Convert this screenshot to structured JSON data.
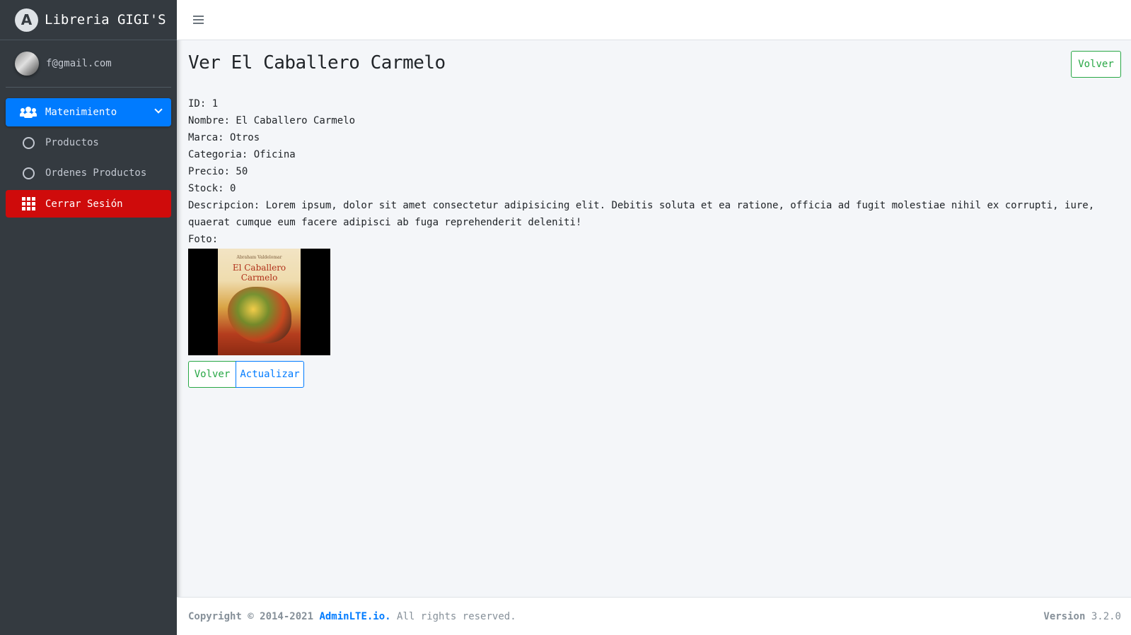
{
  "brand": {
    "name": "Libreria GIGI'S",
    "logo_letter": "A"
  },
  "user": {
    "email": "f@gmail.com"
  },
  "sidebar": {
    "items": [
      {
        "label": "Matenimiento",
        "icon": "users-icon",
        "state": "active"
      },
      {
        "label": "Productos",
        "icon": "circle-icon"
      },
      {
        "label": "Ordenes Productos",
        "icon": "circle-icon"
      },
      {
        "label": "Cerrar Sesión",
        "icon": "grid-icon",
        "state": "danger"
      }
    ]
  },
  "page": {
    "title": "Ver El Caballero Carmelo",
    "back_button": "Volver",
    "fields": {
      "id": "ID: 1",
      "nombre": "Nombre: El Caballero Carmelo",
      "marca": "Marca: Otros",
      "categoria": "Categoria: Oficina",
      "precio": "Precio: 50",
      "stock": "Stock: 0",
      "descripcion": "Descripcion: Lorem ipsum, dolor sit amet consectetur adipisicing elit. Debitis soluta et ea ratione, officia ad fugit molestiae nihil ex corrupti, iure, quaerat cumque eum facere adipisci ab fuga reprehenderit deleniti!",
      "foto": "Foto:"
    },
    "cover": {
      "author": "Abraham Valdelomar",
      "title": "El Caballero Carmelo"
    },
    "actions": {
      "volver": "Volver",
      "actualizar": "Actualizar"
    }
  },
  "footer": {
    "copyright": "Copyright © 2014-2021",
    "link": "AdminLTE.io.",
    "rights": "All rights reserved.",
    "version_label": "Version",
    "version": "3.2.0"
  },
  "colors": {
    "sidebar": "#343a40",
    "primary": "#007bff",
    "danger": "#cf0b0b",
    "success": "#28a745"
  }
}
